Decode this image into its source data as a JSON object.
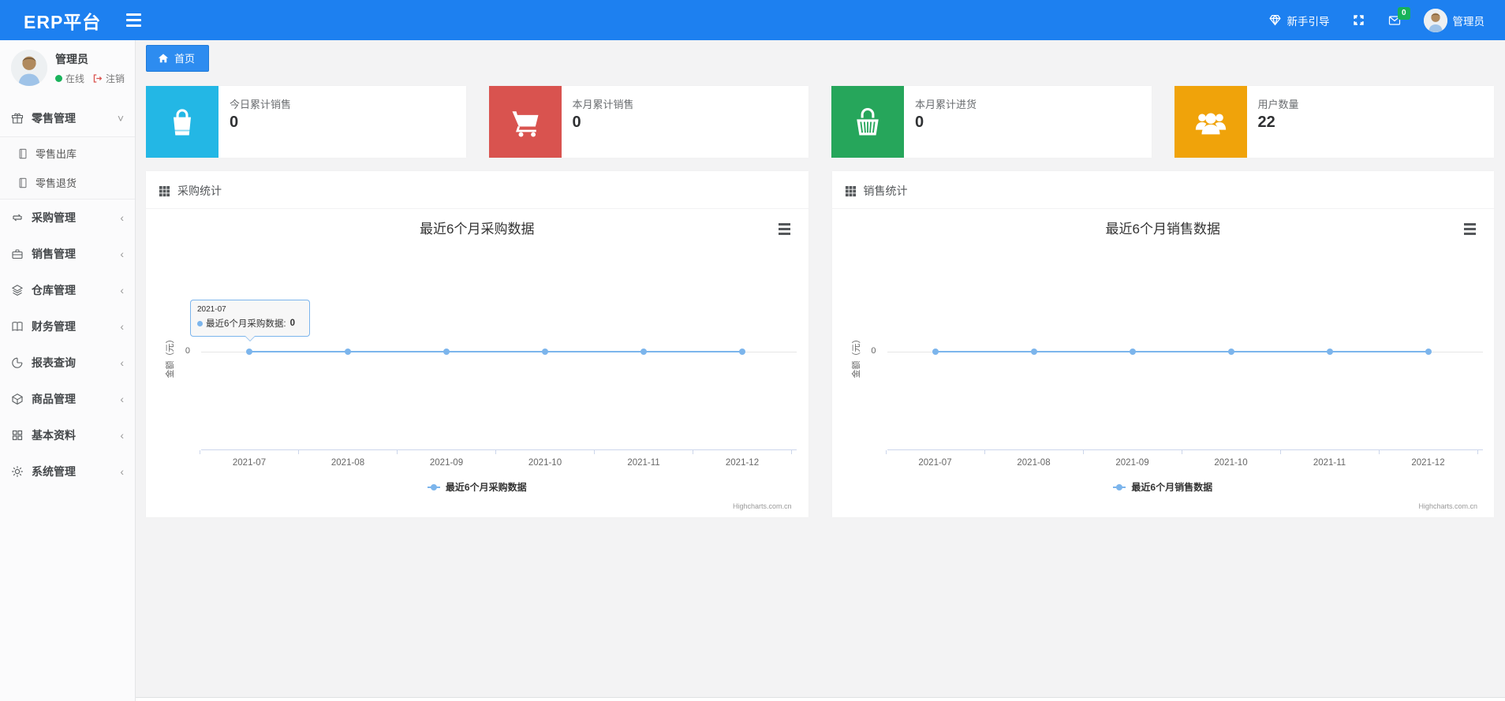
{
  "navbar": {
    "brand": "ERP平台",
    "guide_label": "新手引导",
    "badge_count": "0",
    "user_name": "管理员",
    "icons": [
      "menu-bars-icon",
      "gem-icon",
      "fullscreen-icon",
      "envelope-icon",
      "avatar"
    ]
  },
  "sidebar": {
    "user": {
      "name": "管理员",
      "status": "在线",
      "logout": "注销"
    },
    "menu": [
      {
        "label": "零售管理",
        "icon": "gift-icon",
        "expanded": true,
        "children": [
          {
            "label": "零售出库",
            "icon": "file-icon"
          },
          {
            "label": "零售退货",
            "icon": "file-icon"
          }
        ]
      },
      {
        "label": "采购管理",
        "icon": "repeat-icon"
      },
      {
        "label": "销售管理",
        "icon": "briefcase-icon"
      },
      {
        "label": "仓库管理",
        "icon": "layers-icon"
      },
      {
        "label": "财务管理",
        "icon": "book-icon"
      },
      {
        "label": "报表查询",
        "icon": "pie-chart-icon"
      },
      {
        "label": "商品管理",
        "icon": "box-icon"
      },
      {
        "label": "基本资料",
        "icon": "grid-icon"
      },
      {
        "label": "系统管理",
        "icon": "gear-icon"
      }
    ]
  },
  "breadcrumb": {
    "home": "首页"
  },
  "stats": [
    {
      "label": "今日累计销售",
      "value": "0",
      "color": "#23b7e5",
      "icon": "shopping-bag-icon"
    },
    {
      "label": "本月累计销售",
      "value": "0",
      "color": "#d9534f",
      "icon": "shopping-cart-icon"
    },
    {
      "label": "本月累计进货",
      "value": "0",
      "color": "#26a65b",
      "icon": "shopping-basket-icon"
    },
    {
      "label": "用户数量",
      "value": "22",
      "color": "#f0a30a",
      "icon": "users-icon"
    }
  ],
  "panels": [
    {
      "title": "采购统计"
    },
    {
      "title": "销售统计"
    }
  ],
  "chart_data": [
    {
      "type": "line",
      "title": "最近6个月采购数据",
      "categories": [
        "2021-07",
        "2021-08",
        "2021-09",
        "2021-10",
        "2021-11",
        "2021-12"
      ],
      "series": [
        {
          "name": "最近6个月采购数据",
          "values": [
            0,
            0,
            0,
            0,
            0,
            0
          ]
        }
      ],
      "ylabel": "金额（元）",
      "ytick": "0",
      "color": "#7cb5ec",
      "legend_position": "bottom-center",
      "grid": true,
      "credits": "Highcharts.com.cn",
      "tooltip": {
        "header": "2021-07",
        "label": "最近6个月采购数据: ",
        "value": "0"
      }
    },
    {
      "type": "line",
      "title": "最近6个月销售数据",
      "categories": [
        "2021-07",
        "2021-08",
        "2021-09",
        "2021-10",
        "2021-11",
        "2021-12"
      ],
      "series": [
        {
          "name": "最近6个月销售数据",
          "values": [
            0,
            0,
            0,
            0,
            0,
            0
          ]
        }
      ],
      "ylabel": "金额（元）",
      "ytick": "0",
      "color": "#7cb5ec",
      "legend_position": "bottom-center",
      "grid": true,
      "credits": "Highcharts.com.cn"
    }
  ]
}
